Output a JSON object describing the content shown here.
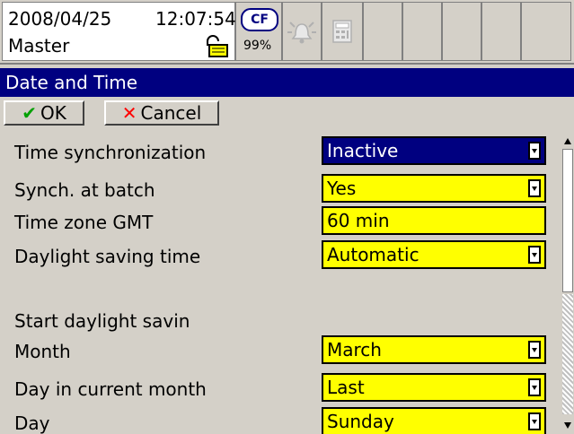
{
  "status": {
    "date": "2008/04/25",
    "time": "12:07:54",
    "user": "Master",
    "cf_label": "CF",
    "cf_percent": "99%"
  },
  "title": "Date and Time",
  "buttons": {
    "ok": "OK",
    "cancel": "Cancel"
  },
  "fields": [
    {
      "label": "Time synchronization",
      "value": "Inactive",
      "dropdown": true,
      "active": true
    },
    {
      "label": "Synch. at batch",
      "value": "Yes",
      "dropdown": true
    },
    {
      "label": "Time zone GMT",
      "value": "60 min",
      "dropdown": false
    },
    {
      "label": "Daylight saving time",
      "value": "Automatic",
      "dropdown": true
    }
  ],
  "section": "Start daylight savin",
  "start_fields": [
    {
      "label": "Month",
      "value": "March",
      "dropdown": true
    },
    {
      "label": "Day in current month",
      "value": "Last",
      "dropdown": true
    },
    {
      "label": "Day",
      "value": "Sunday",
      "dropdown": true
    }
  ],
  "colors": {
    "titlebar": "#000080",
    "field": "#ffff00",
    "field_active": "#000080"
  },
  "icons": {
    "lock": "lock-icon",
    "alarm": "alarm-bell-icon",
    "calc": "calculator-icon",
    "ok": "checkmark-icon",
    "cancel": "x-mark-icon"
  }
}
